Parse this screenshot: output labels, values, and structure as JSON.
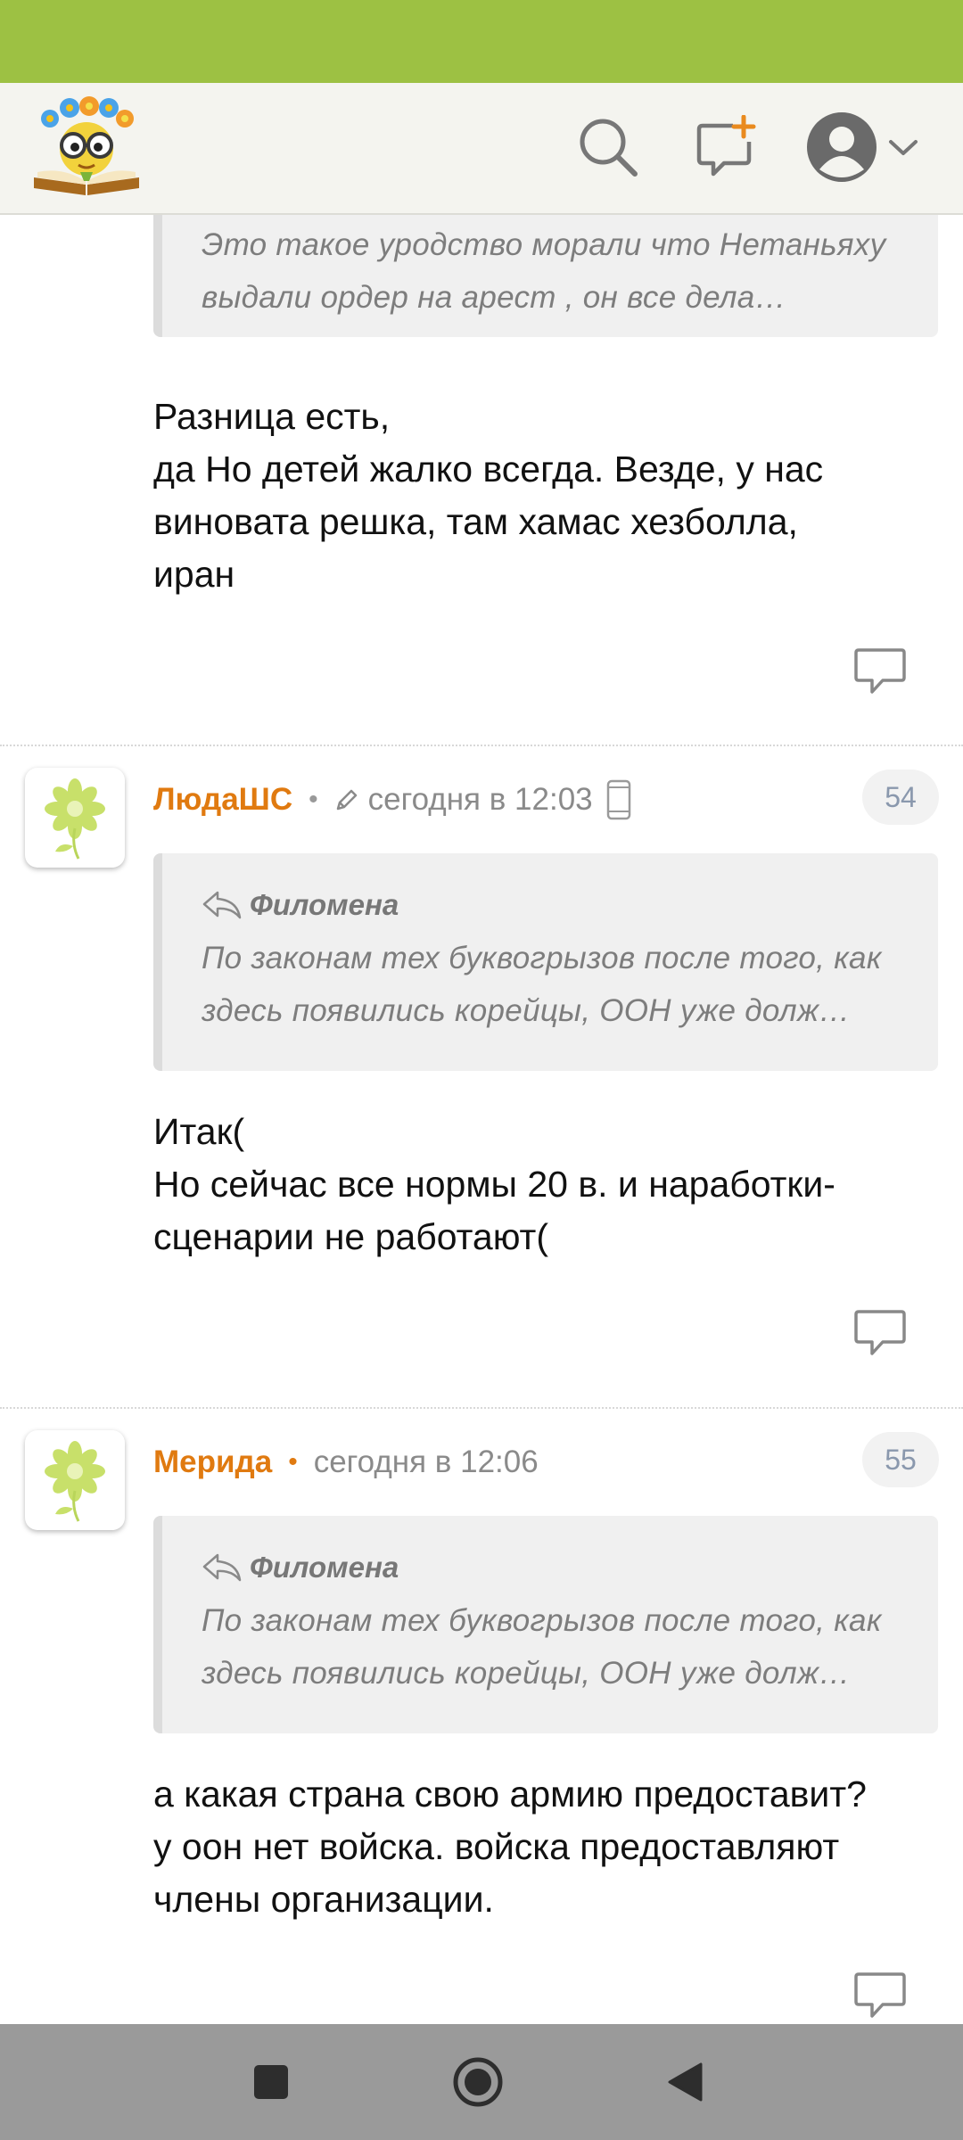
{
  "header": {
    "logo_icon": "book-with-glasses-logo",
    "search_icon": "search-icon",
    "compose_icon": "new-message-icon",
    "profile_icon": "user-avatar-icon"
  },
  "comments": [
    {
      "quote": {
        "text": "Это такое уродство морали что Нетаньяху выдали ордер на арест , он все дела…"
      },
      "body_lines": [
        "Разница есть,",
        "да Но детей жалко всегда. Везде, у нас",
        "виновата решка, там хамас хезболла,",
        "иран"
      ]
    },
    {
      "author": "ЛюдаШС",
      "edited": true,
      "time": "сегодня в 12:03",
      "device": "mobile",
      "number": "54",
      "quote": {
        "author": "Филомена",
        "text": "По законам тех буквогрызов после того, как здесь появились корейцы, ООН уже долж…"
      },
      "body_lines": [
        "Итак(",
        "Но сейчас все нормы 20 в. и наработки-",
        "сценарии не работают("
      ]
    },
    {
      "author": "Мерида",
      "time": "сегодня в 12:06",
      "number": "55",
      "quote": {
        "author": "Филомена",
        "text": "По законам тех буквогрызов после того, как здесь появились корейцы, ООН уже долж…"
      },
      "body_lines": [
        "а какая страна свою армию предоставит?",
        "у оон нет войска. войска предоставляют",
        "члены организации."
      ]
    }
  ],
  "colors": {
    "status_bar": "#9dc143",
    "author_name": "#e07a10",
    "badge_text": "#8a98ad",
    "nav_bar": "#9a9a9a"
  },
  "nav": {
    "recent_icon": "square-icon",
    "home_icon": "circle-home-icon",
    "back_icon": "triangle-back-icon"
  }
}
